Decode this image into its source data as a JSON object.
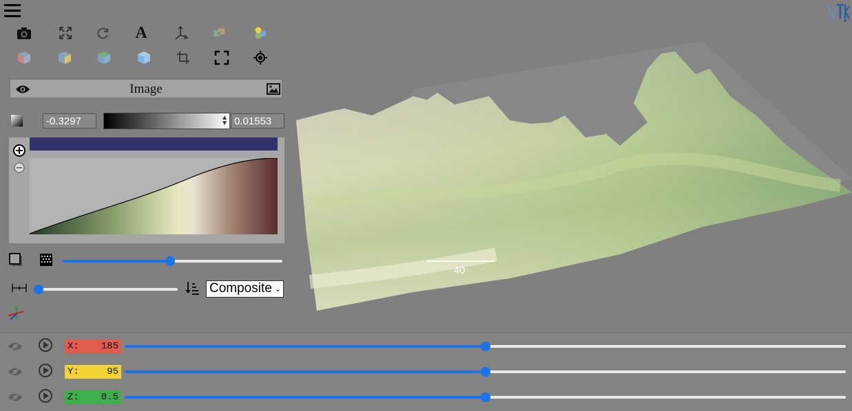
{
  "toolbar": {
    "menu_icon": "hamburger-menu-icon",
    "row1": [
      "camera-icon",
      "fit-to-screen-icon",
      "rotate-icon",
      "text-annotation-icon",
      "axes-icon",
      "orientation-icon",
      "colors-icon"
    ],
    "row2": [
      "cube-x-icon",
      "cube-y-icon",
      "cube-z-icon",
      "cube-iso-icon",
      "crop-icon",
      "fullscreen-icon",
      "target-icon"
    ]
  },
  "panel": {
    "title": "Image",
    "range_min": "-0.3297",
    "range_max": "0.01553",
    "mode_options": [
      "Composite"
    ],
    "mode_selected": "Composite",
    "opacity_value": 0.49,
    "sample_distance_value": 0.0
  },
  "colormap": {
    "bar_color": "#303269",
    "stops": [
      "#233b2a",
      "#8ea36e",
      "#e8e8c0",
      "#e8e1d0",
      "#a58a7a",
      "#5a2d2d"
    ]
  },
  "scene": {
    "scale_label": "40"
  },
  "slices": [
    {
      "axis": "X:",
      "value": "185",
      "color": "#e05a4e",
      "fraction": 0.5
    },
    {
      "axis": "Y:",
      "value": "95",
      "color": "#f3d334",
      "fraction": 0.5
    },
    {
      "axis": "Z:",
      "value": "0.5",
      "color": "#3fae4c",
      "fraction": 0.5
    }
  ]
}
